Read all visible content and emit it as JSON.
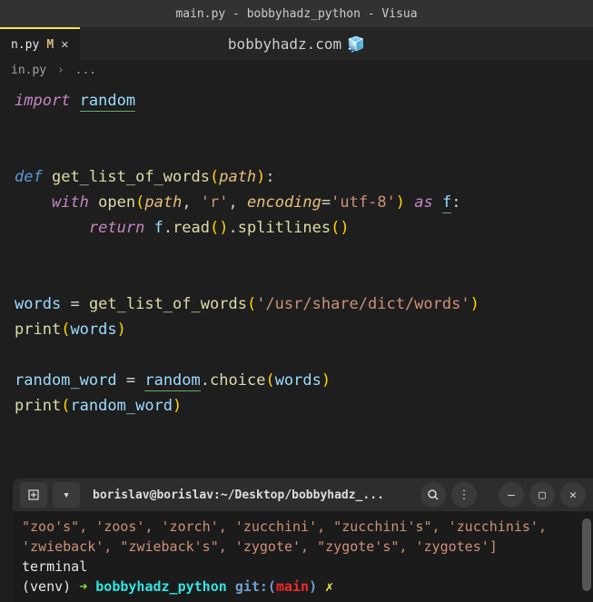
{
  "titleBar": "main.py - bobbyhadz_python - Visua",
  "tab": {
    "name": "n.py",
    "modified": "M"
  },
  "watermark": "bobbyhadz.com",
  "breadcrumb": {
    "file": "in.py",
    "sep": "›",
    "rest": "..."
  },
  "code": {
    "import": "import",
    "random": "random",
    "def": "def",
    "fnName": "get_list_of_words",
    "path": "path",
    "with": "with",
    "open": "open",
    "r": "'r'",
    "encoding": "encoding",
    "utf8": "'utf-8'",
    "as": "as",
    "f": "f",
    "return": "return",
    "read": "read",
    "splitlines": "splitlines",
    "words": "words",
    "dictPath": "'/usr/share/dict/words'",
    "print": "print",
    "random_word": "random_word",
    "choice": "choice",
    "eq": "="
  },
  "terminal": {
    "title": "borislav@borislav:~/Desktop/bobbyhadz_...",
    "output1": "\"zoo's\", 'zoos', 'zorch', 'zucchini', \"zucchini's\", 'zucchinis', 'zwieback', \"zwieback's\", 'zygote', \"zygote's\", 'zygotes']",
    "output2": "terminal",
    "prompt": {
      "venv": "(venv)",
      "arrow": "➜",
      "dir": "bobbyhadz_python",
      "git": "git:(",
      "branch": "main",
      "gitClose": ")",
      "dirty": "✗"
    }
  }
}
